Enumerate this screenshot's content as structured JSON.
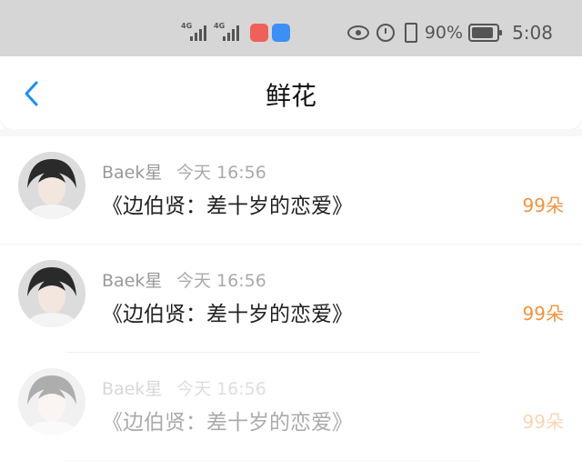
{
  "status_bar": {
    "network1": "4G",
    "network2": "4G",
    "battery_text": "90%",
    "battery_level": 0.9,
    "time": "5:08",
    "app_colors": [
      "#f0605a",
      "#3b8ff5"
    ]
  },
  "nav": {
    "title": "鲜花",
    "back_icon": "chevron-left-icon",
    "accent": "#1e8ef0"
  },
  "items": [
    {
      "name": "Baek星",
      "time": "今天 16:56",
      "message": "《边伯贤：差十岁的恋爱》",
      "count": "99朵"
    },
    {
      "name": "Baek星",
      "time": "今天 16:56",
      "message": "《边伯贤：差十岁的恋爱》",
      "count": "99朵"
    },
    {
      "name": "Baek星",
      "time": "今天 16:56",
      "message": "《边伯贤：差十岁的恋爱》",
      "count": "99朵"
    }
  ],
  "colors": {
    "count": "#f09340",
    "status_bar_bg": "#d6d6d6"
  }
}
